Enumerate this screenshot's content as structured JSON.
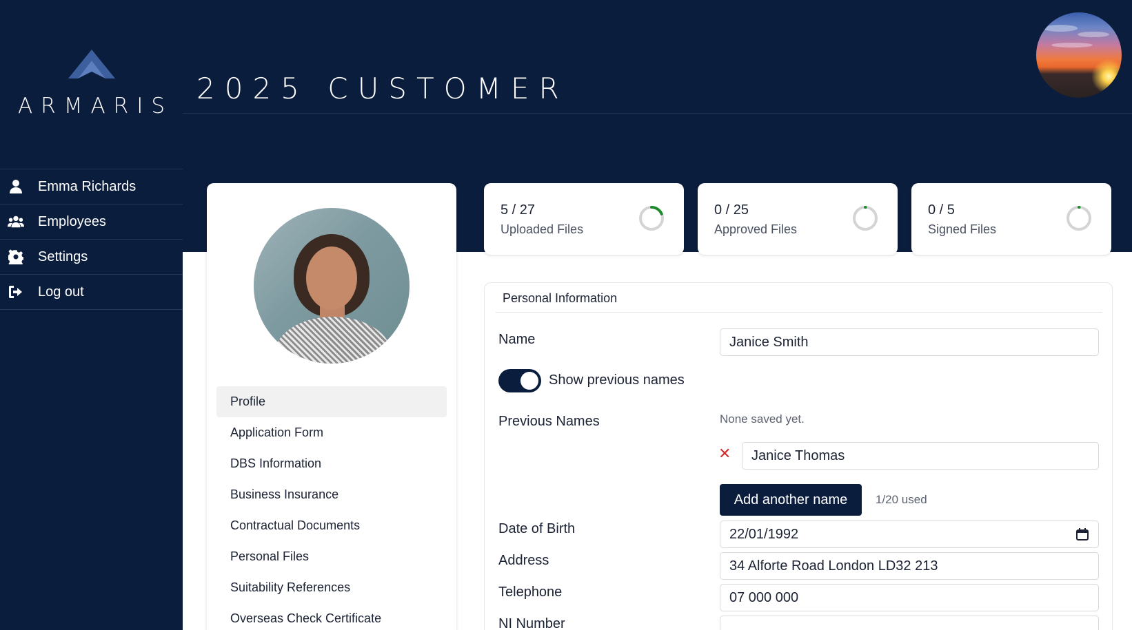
{
  "brand": {
    "name": "ARMARIS"
  },
  "header": {
    "title": "2025 CUSTOMER"
  },
  "sidebar": {
    "items": [
      {
        "label": "Emma Richards",
        "icon": "user-icon"
      },
      {
        "label": "Employees",
        "icon": "users-icon"
      },
      {
        "label": "Settings",
        "icon": "gear-icon"
      },
      {
        "label": "Log out",
        "icon": "logout-icon"
      }
    ]
  },
  "profile_menu": {
    "items": [
      {
        "label": "Profile",
        "active": true
      },
      {
        "label": "Application Form"
      },
      {
        "label": "DBS Information"
      },
      {
        "label": "Business Insurance"
      },
      {
        "label": "Contractual Documents"
      },
      {
        "label": "Personal Files"
      },
      {
        "label": "Suitability References"
      },
      {
        "label": "Overseas Check Certificate"
      }
    ]
  },
  "stats": [
    {
      "count": "5 / 27",
      "label": "Uploaded Files",
      "done": 5,
      "total": 27
    },
    {
      "count": "0 / 25",
      "label": "Approved Files",
      "done": 0,
      "total": 25
    },
    {
      "count": "0 / 5",
      "label": "Signed Files",
      "done": 0,
      "total": 5
    }
  ],
  "personal_info": {
    "heading": "Personal Information",
    "name_label": "Name",
    "name_value": "Janice Smith",
    "toggle_label": "Show previous names",
    "toggle_on": true,
    "previous_names_label": "Previous Names",
    "previous_names_empty": "None saved yet.",
    "previous_name_value": "Janice Thomas",
    "add_button": "Add another name",
    "used_text": "1/20 used",
    "dob_label": "Date of Birth",
    "dob_value": "22/01/1992",
    "address_label": "Address",
    "address_value": "34 Alforte Road London LD32 213",
    "telephone_label": "Telephone",
    "telephone_value": "07 000 000",
    "ni_label": "NI Number"
  },
  "colors": {
    "navy": "#0b1d3d",
    "progress_green": "#1e8a2e",
    "remove_red": "#d22c2c"
  }
}
